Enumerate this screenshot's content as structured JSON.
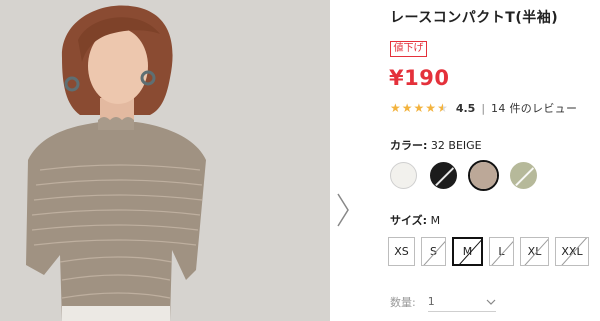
{
  "product": {
    "title": "レースコンパクトT(半袖)",
    "sale_badge": "値下げ",
    "price": "¥190",
    "rating": {
      "stars_value": 4.5,
      "score": "4.5",
      "separator": "|",
      "review_count": "14 件のレビュー"
    }
  },
  "color": {
    "label": "カラー:",
    "selected_value": "32 BEIGE",
    "swatches": [
      {
        "name": "white",
        "hex": "#f2f1ed",
        "available": true,
        "selected": false
      },
      {
        "name": "black",
        "hex": "#1c1c1c",
        "available": false,
        "selected": false
      },
      {
        "name": "beige",
        "hex": "#bca898",
        "available": true,
        "selected": true
      },
      {
        "name": "green",
        "hex": "#b6b99a",
        "available": false,
        "selected": false
      }
    ]
  },
  "size": {
    "label": "サイズ:",
    "selected_value": "M",
    "options": [
      {
        "label": "XS",
        "available": true,
        "selected": false
      },
      {
        "label": "S",
        "available": false,
        "selected": false
      },
      {
        "label": "M",
        "available": false,
        "selected": true
      },
      {
        "label": "L",
        "available": false,
        "selected": false
      },
      {
        "label": "XL",
        "available": false,
        "selected": false
      },
      {
        "label": "XXL",
        "available": false,
        "selected": false
      }
    ]
  },
  "quantity": {
    "label": "数量:",
    "value": "1"
  },
  "colors": {
    "accent_red": "#e4313b",
    "star": "#f3b33e"
  }
}
